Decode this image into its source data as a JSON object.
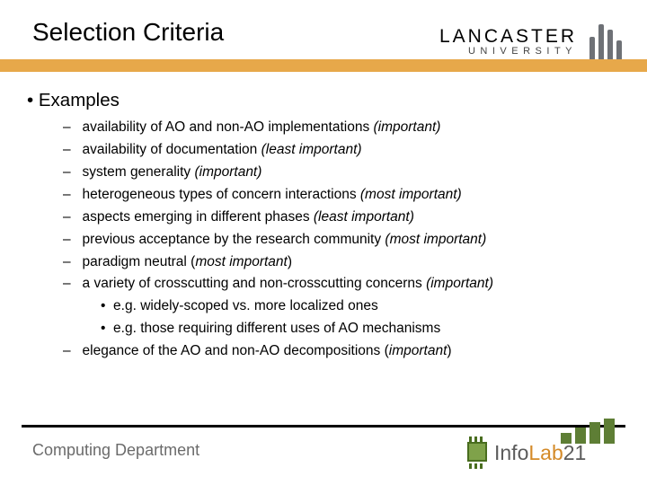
{
  "title": "Selection Criteria",
  "header_logo": {
    "top": "LANCASTER",
    "bottom": "UNIVERSITY"
  },
  "bullets": {
    "lvl1": "Examples",
    "items": [
      {
        "text": "availability of AO and non-AO implementations ",
        "note": "(important)"
      },
      {
        "text": "availability of documentation ",
        "note": "(least important)"
      },
      {
        "text": "system generality ",
        "note": "(important)"
      },
      {
        "text": "heterogeneous types of concern interactions ",
        "note": "(most important)"
      },
      {
        "text": "aspects emerging in different phases ",
        "note": "(least important)"
      },
      {
        "text": "previous acceptance by the research community ",
        "note": "(most important)"
      },
      {
        "text": "paradigm neutral (",
        "note": "most important",
        "tail": ")"
      },
      {
        "text": "a variety of crosscutting and non-crosscutting concerns ",
        "note": "(important)",
        "sub": [
          "e.g. widely-scoped vs. more localized ones",
          "e.g. those requiring different uses of AO mechanisms"
        ]
      },
      {
        "text": "elegance of the AO and non-AO decompositions (",
        "note": "important",
        "tail": ")"
      }
    ]
  },
  "footer": {
    "department": "Computing Department",
    "logo_main": "Info",
    "logo_accent": "Lab",
    "logo_suffix": "21"
  }
}
